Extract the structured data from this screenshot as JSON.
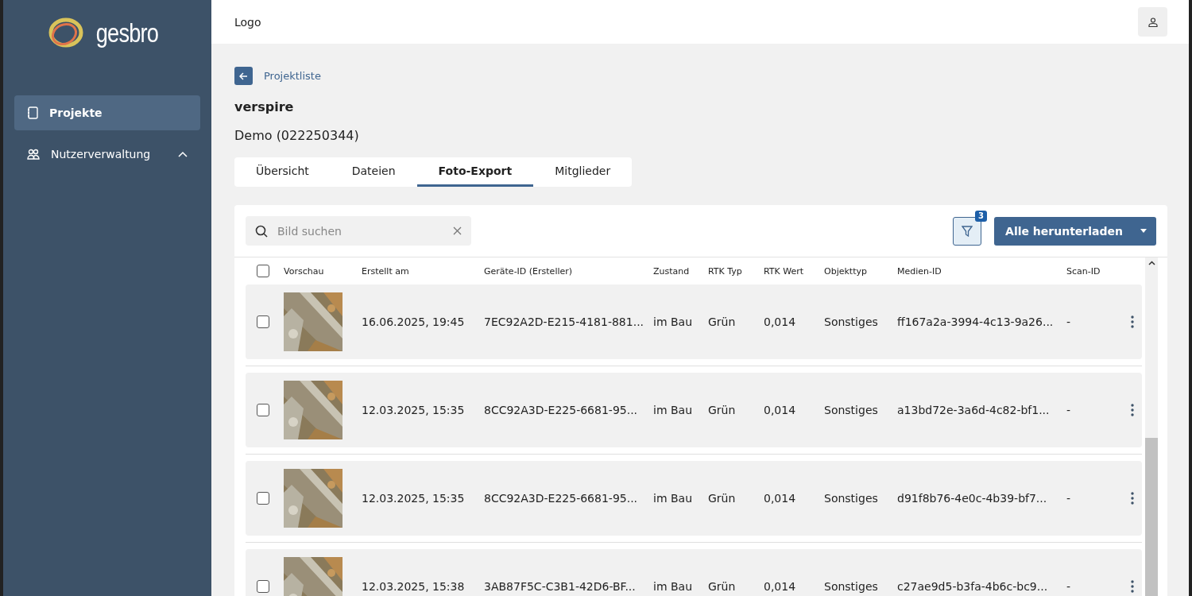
{
  "sidebar": {
    "logo": "gesbro",
    "items": [
      {
        "label": "Projekte",
        "kind": "page",
        "selected": true
      },
      {
        "label": "Nutzerverwaltung",
        "kind": "group",
        "selected": false,
        "expanded": true
      }
    ]
  },
  "header": {
    "title": "Logo"
  },
  "breadcrumb": {
    "label": "Projektliste"
  },
  "project": {
    "name": "verspire",
    "subtitle": "Demo (022250344)"
  },
  "tabs": [
    {
      "label": "Übersicht",
      "selected": false
    },
    {
      "label": "Dateien",
      "selected": false
    },
    {
      "label": "Foto-Export",
      "selected": true
    },
    {
      "label": "Mitglieder",
      "selected": false
    }
  ],
  "toolbar": {
    "search": {
      "placeholder": "Bild suchen"
    },
    "filter_count": "3",
    "download_button": "Alle herunterladen"
  },
  "table": {
    "select_all_checked": false,
    "preview_column": "Vorschau",
    "columns": [
      "Erstellt am",
      "Geräte-ID (Ersteller)",
      "Zustand",
      "RTK Typ",
      "RTK Wert",
      "Objekttyp",
      "Medien-ID",
      "Scan-ID"
    ],
    "rows": [
      {
        "checked": false,
        "cells": [
          "16.06.2025, 19:45",
          "7EC92A2D-E215-4181-881...",
          "im Bau",
          "Grün",
          "0,014",
          "Sonstiges",
          "ff167a2a-3994-4c13-9a26...",
          "-"
        ]
      },
      {
        "checked": false,
        "cells": [
          "12.03.2025, 15:35",
          "8CC92A3D-E225-6681-95...",
          "im Bau",
          "Grün",
          "0,014",
          "Sonstiges",
          "a13bd72e-3a6d-4c82-bf1...",
          "-"
        ]
      },
      {
        "checked": false,
        "cells": [
          "12.03.2025, 15:35",
          "8CC92A3D-E225-6681-95...",
          "im Bau",
          "Grün",
          "0,014",
          "Sonstiges",
          "d91f8b76-4e0c-4b39-bf7...",
          "-"
        ]
      },
      {
        "checked": false,
        "cells": [
          "12.03.2025, 15:38",
          "3AB87F5C-C3B1-42D6-BF...",
          "im Bau",
          "Grün",
          "0,014",
          "Sonstiges",
          "c27ae9d5-b3fa-4b6c-bc9...",
          "-"
        ]
      }
    ]
  }
}
